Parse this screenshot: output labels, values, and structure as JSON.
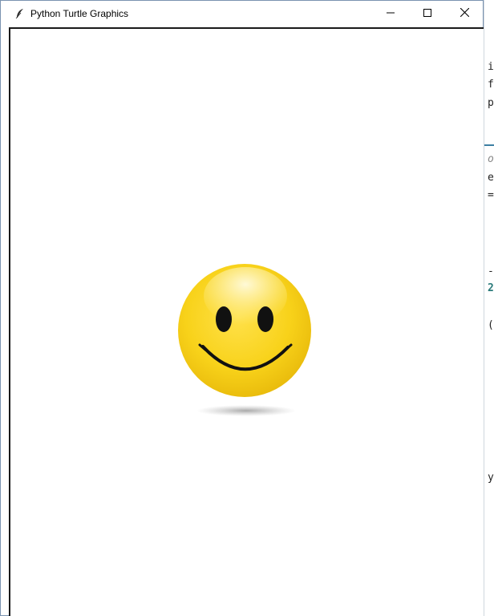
{
  "window": {
    "title": "Python Turtle Graphics",
    "icons": {
      "app": "feather-icon",
      "minimize": "minimize-icon",
      "maximize": "maximize-icon",
      "close": "close-icon"
    }
  },
  "canvas": {
    "background": "#ffffff",
    "drawing": "smiley-face"
  },
  "background_editor": {
    "fragments": [
      "i",
      "f",
      "p",
      "o",
      "e",
      "=",
      "-",
      "2",
      "(",
      "y"
    ]
  },
  "colors": {
    "face_yellow": "#f7d21a",
    "face_highlight": "#fff6c8",
    "features": "#111111",
    "window_border": "#7a93b0"
  }
}
